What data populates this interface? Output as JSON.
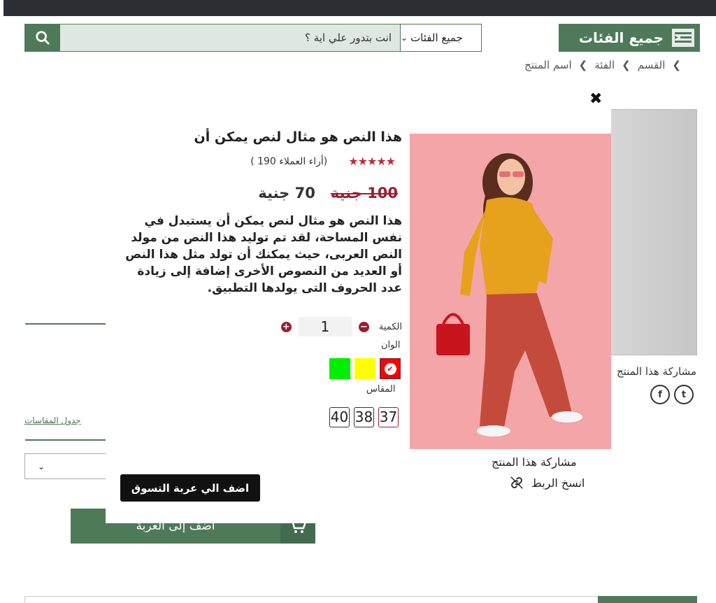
{
  "header": {
    "search_placeholder": "انت بتدور علي اية ؟",
    "category_select": "جميع الفئات",
    "all_categories_label": "جميع الفئات"
  },
  "breadcrumb": {
    "items": [
      "القسم",
      "الفئة",
      "اسم المنتج"
    ]
  },
  "background_page": {
    "share_label": "مشاركة هذا المنتج",
    "social": [
      "facebook-icon",
      "twitter-icon"
    ],
    "size_table_link": "جدول المقاسات",
    "add_to_cart": "أضف إلى العربة"
  },
  "modal": {
    "product_title": "هذا النص هو مثال لنص يمكن أن",
    "rating_value": 4.5,
    "rating_stars": "★★★★★",
    "reviews_text": "(أراء العملاء 190 )",
    "old_price": "100 جنية",
    "new_price": "70 جنية",
    "description": "هذا النص هو مثال لنص يمكن أن يستبدل في نفس المساحة، لقد تم توليد هذا النص من مولد النص العربى، حيث يمكنك أن تولد مثل هذا النص أو العديد من النصوص الأخرى إضافة إلى زيادة عدد الحروف التى يولدها التطبيق.",
    "quantity_label": "الكمية",
    "quantity_value": "1",
    "colors_label": "الوان",
    "colors": [
      {
        "hex": "#ff0000",
        "selected": true
      },
      {
        "hex": "#ffff00",
        "selected": false
      },
      {
        "hex": "#00ee00",
        "selected": false
      }
    ],
    "size_label": "المقاس",
    "sizes": [
      {
        "label": "37",
        "selected": true
      },
      {
        "label": "38",
        "selected": false
      },
      {
        "label": "40",
        "selected": false
      }
    ],
    "share_title": "مشاركة هذا المنتج",
    "copy_link": "انسخ الربط",
    "add_to_cart_button": "اضف الي عربة التسوق"
  },
  "colors": {
    "brand_green": "#4e7a5a",
    "accent_red": "#9b1d2f",
    "dark": "#111111"
  }
}
